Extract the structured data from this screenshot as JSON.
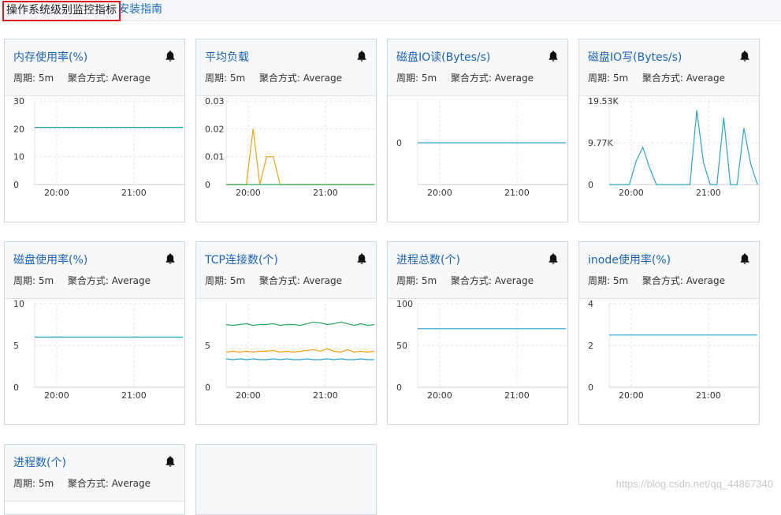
{
  "header": {
    "section_title": "操作系统级别监控指标",
    "guide_link": "安装指南"
  },
  "labels": {
    "period": "周期:",
    "aggregation": "聚合方式:"
  },
  "colors": {
    "blue_series": "#2ba3c7",
    "orange_series": "#f0a21a",
    "green_series": "#2aa763",
    "title_link": "#1d63b3",
    "highlight_border": "#e0141c"
  },
  "cards": [
    {
      "title": "内存使用率(%)",
      "period": "5m",
      "aggregation": "Average",
      "alarm_icon": "bell-icon",
      "chart_data": {
        "type": "line",
        "x_ticks": [
          "20:00",
          "21:00"
        ],
        "y_ticks": [
          "0",
          "10",
          "20",
          "30"
        ],
        "ylim": [
          0,
          30
        ],
        "series": [
          {
            "color": "#2ba3c7",
            "values": [
              20.5,
              20.5,
              20.5,
              20.5,
              20.5,
              20.5,
              20.5,
              20.5,
              20.5,
              20.5,
              20.5,
              20.5,
              20.5,
              20.5,
              20.5,
              20.5,
              20.5,
              20.5,
              20.5,
              20.5,
              20.5,
              20.5,
              20.5
            ]
          }
        ]
      }
    },
    {
      "title": "平均负载",
      "period": "5m",
      "aggregation": "Average",
      "alarm_icon": "bell-icon",
      "chart_data": {
        "type": "line",
        "x_ticks": [
          "20:00",
          "21:00"
        ],
        "y_ticks": [
          "0",
          "0.01",
          "0.02",
          "0.03"
        ],
        "ylim": [
          0,
          0.03
        ],
        "series": [
          {
            "color": "#f0a21a",
            "values": [
              0,
              0,
              0,
              0,
              0.02,
              0,
              0.01,
              0.01,
              0,
              0,
              0,
              0,
              0,
              0,
              0,
              0,
              0,
              0,
              0,
              0,
              0,
              0,
              0
            ]
          },
          {
            "color": "#2aa763",
            "values": [
              0,
              0,
              0,
              0,
              0,
              0,
              0,
              0,
              0,
              0,
              0,
              0,
              0,
              0,
              0,
              0,
              0,
              0,
              0,
              0,
              0,
              0,
              0
            ]
          }
        ]
      }
    },
    {
      "title": "磁盘IO读(Bytes/s)",
      "period": "5m",
      "aggregation": "Average",
      "alarm_icon": "bell-icon",
      "chart_data": {
        "type": "line",
        "x_ticks": [
          "20:00",
          "21:00"
        ],
        "y_ticks": [
          "0"
        ],
        "ylim": [
          -1,
          1
        ],
        "series": [
          {
            "color": "#2ba3c7",
            "values": [
              0,
              0,
              0,
              0,
              0,
              0,
              0,
              0,
              0,
              0,
              0,
              0,
              0,
              0,
              0,
              0,
              0,
              0,
              0,
              0,
              0,
              0,
              0
            ]
          }
        ]
      }
    },
    {
      "title": "磁盘IO写(Bytes/s)",
      "period": "5m",
      "aggregation": "Average",
      "alarm_icon": "bell-icon",
      "chart_data": {
        "type": "line",
        "x_ticks": [
          "20:00",
          "21:00"
        ],
        "y_ticks": [
          "0",
          "9.77K",
          "19.53K"
        ],
        "ylim": [
          0,
          20000
        ],
        "series": [
          {
            "color": "#2ba3c7",
            "values": [
              0,
              0,
              0,
              0,
              5600,
              8900,
              4000,
              0,
              0,
              0,
              0,
              0,
              0,
              17800,
              5300,
              0,
              0,
              16000,
              0,
              0,
              13500,
              5000,
              0
            ]
          }
        ]
      }
    },
    {
      "title": "磁盘使用率(%)",
      "period": "5m",
      "aggregation": "Average",
      "alarm_icon": "bell-icon",
      "chart_data": {
        "type": "line",
        "x_ticks": [
          "20:00",
          "21:00"
        ],
        "y_ticks": [
          "0",
          "5",
          "10"
        ],
        "ylim": [
          0,
          10
        ],
        "series": [
          {
            "color": "#2ba3c7",
            "values": [
              6,
              6,
              6,
              6,
              6,
              6,
              6,
              6,
              6,
              6,
              6,
              6,
              6,
              6,
              6,
              6,
              6,
              6,
              6,
              6,
              6,
              6,
              6
            ]
          }
        ]
      }
    },
    {
      "title": "TCP连接数(个)",
      "period": "5m",
      "aggregation": "Average",
      "alarm_icon": "bell-icon",
      "chart_data": {
        "type": "line",
        "x_ticks": [
          "20:00",
          "21:00"
        ],
        "y_ticks": [
          "0",
          "5"
        ],
        "ylim": [
          0,
          10
        ],
        "series": [
          {
            "color": "#2aa763",
            "values": [
              7.5,
              7.4,
              7.5,
              7.6,
              7.4,
              7.5,
              7.5,
              7.6,
              7.4,
              7.5,
              7.5,
              7.4,
              7.6,
              7.8,
              7.7,
              7.5,
              7.6,
              7.8,
              7.6,
              7.4,
              7.6,
              7.4,
              7.5
            ]
          },
          {
            "color": "#f0a21a",
            "values": [
              4.2,
              4.3,
              4.2,
              4.3,
              4.2,
              4.3,
              4.3,
              4.4,
              4.2,
              4.3,
              4.2,
              4.3,
              4.4,
              4.5,
              4.3,
              4.6,
              4.3,
              4.2,
              4.5,
              4.2,
              4.3,
              4.2,
              4.3
            ]
          },
          {
            "color": "#2ba3c7",
            "values": [
              3.4,
              3.3,
              3.4,
              3.3,
              3.4,
              3.3,
              3.3,
              3.4,
              3.3,
              3.4,
              3.3,
              3.3,
              3.4,
              3.3,
              3.3,
              3.4,
              3.3,
              3.4,
              3.3,
              3.3,
              3.4,
              3.3,
              3.3
            ]
          }
        ]
      }
    },
    {
      "title": "进程总数(个)",
      "period": "5m",
      "aggregation": "Average",
      "alarm_icon": "bell-icon",
      "chart_data": {
        "type": "line",
        "x_ticks": [
          "20:00",
          "21:00"
        ],
        "y_ticks": [
          "0",
          "50",
          "100"
        ],
        "ylim": [
          0,
          100
        ],
        "series": [
          {
            "color": "#2ba3c7",
            "values": [
              70,
              70,
              70,
              70,
              70,
              70,
              70,
              70,
              70,
              70,
              70,
              70,
              70,
              70,
              70,
              70,
              70,
              70,
              70,
              70,
              70,
              70,
              70
            ]
          }
        ]
      }
    },
    {
      "title": "inode使用率(%)",
      "period": "5m",
      "aggregation": "Average",
      "alarm_icon": "bell-icon",
      "chart_data": {
        "type": "line",
        "x_ticks": [
          "20:00",
          "21:00"
        ],
        "y_ticks": [
          "0",
          "2",
          "4"
        ],
        "ylim": [
          0,
          4
        ],
        "series": [
          {
            "color": "#2ba3c7",
            "values": [
              2.5,
              2.5,
              2.5,
              2.5,
              2.5,
              2.5,
              2.5,
              2.5,
              2.5,
              2.5,
              2.5,
              2.5,
              2.5,
              2.5,
              2.5,
              2.5,
              2.5,
              2.5,
              2.5,
              2.5,
              2.5,
              2.5,
              2.5
            ]
          }
        ]
      }
    },
    {
      "title": "进程数(个)",
      "period": "5m",
      "aggregation": "Average",
      "alarm_icon": "bell-icon",
      "chart_data": null
    }
  ],
  "watermark": "https://blog.csdn.net/qq_44867340"
}
